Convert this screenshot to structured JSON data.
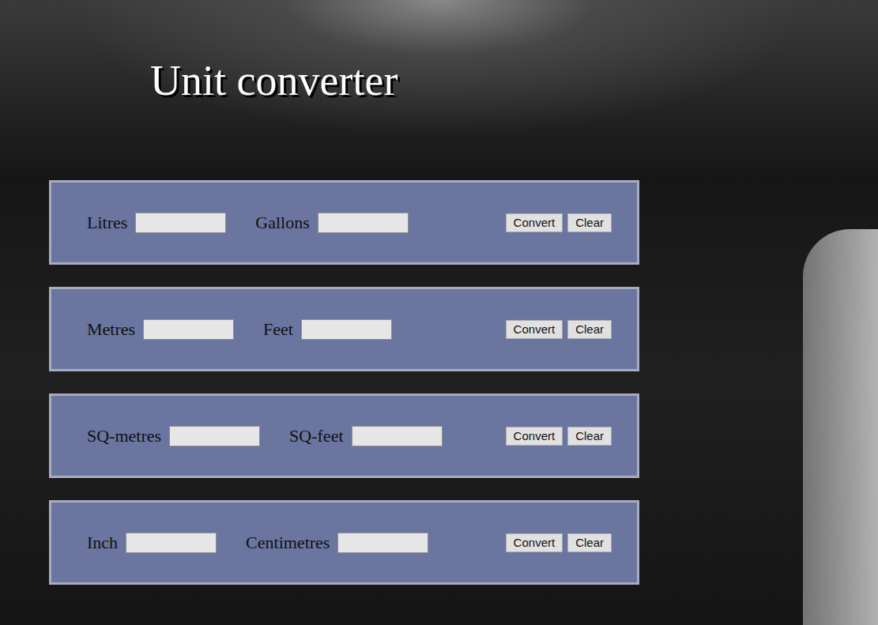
{
  "title": "Unit converter",
  "converters": [
    {
      "from_label": "Litres",
      "from_value": "",
      "to_label": "Gallons",
      "to_value": "",
      "buttons": [
        "Convert",
        "Clear"
      ]
    },
    {
      "from_label": "Metres",
      "from_value": "",
      "to_label": "Feet",
      "to_value": "",
      "buttons": [
        "Convert",
        "Clear"
      ]
    },
    {
      "from_label": "SQ-metres",
      "from_value": "",
      "to_label": "SQ-feet",
      "to_value": "",
      "buttons": [
        "Convert",
        "Clear"
      ]
    },
    {
      "from_label": "Inch",
      "from_value": "",
      "to_label": "Centimetres",
      "to_value": "",
      "buttons": [
        "Convert",
        "Clear"
      ]
    }
  ]
}
